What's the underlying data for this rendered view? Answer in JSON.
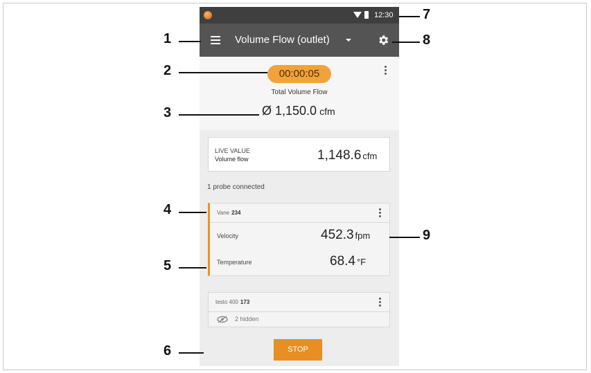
{
  "status_bar": {
    "time": "12:30"
  },
  "app_bar": {
    "title": "Volume Flow (outlet)"
  },
  "summary": {
    "timer": "00:00:05",
    "label": "Total Volume Flow",
    "value": "Ø 1,150.0",
    "unit": "cfm"
  },
  "live": {
    "caption": "LIVE VALUE",
    "subtitle": "Volume flow",
    "value": "1,148.6",
    "unit": "cfm"
  },
  "probes_connected": "1 probe connected",
  "probe1": {
    "type": "Vane",
    "id": "234",
    "rows": [
      {
        "label": "Velocity",
        "value": "452.3",
        "unit": "fpm"
      },
      {
        "label": "Temperature",
        "value": "68.4",
        "unit": "°F"
      }
    ]
  },
  "probe2": {
    "type": "testo 400",
    "id": "173",
    "hidden": "2 hidden"
  },
  "stop_label": "STOP",
  "callouts": [
    "1",
    "2",
    "3",
    "4",
    "5",
    "6",
    "7",
    "8",
    "9"
  ],
  "colors": {
    "accent": "#f2a23a",
    "appbar": "#545454",
    "statusbar": "#3f3f3f",
    "stop": "#e88f24"
  }
}
